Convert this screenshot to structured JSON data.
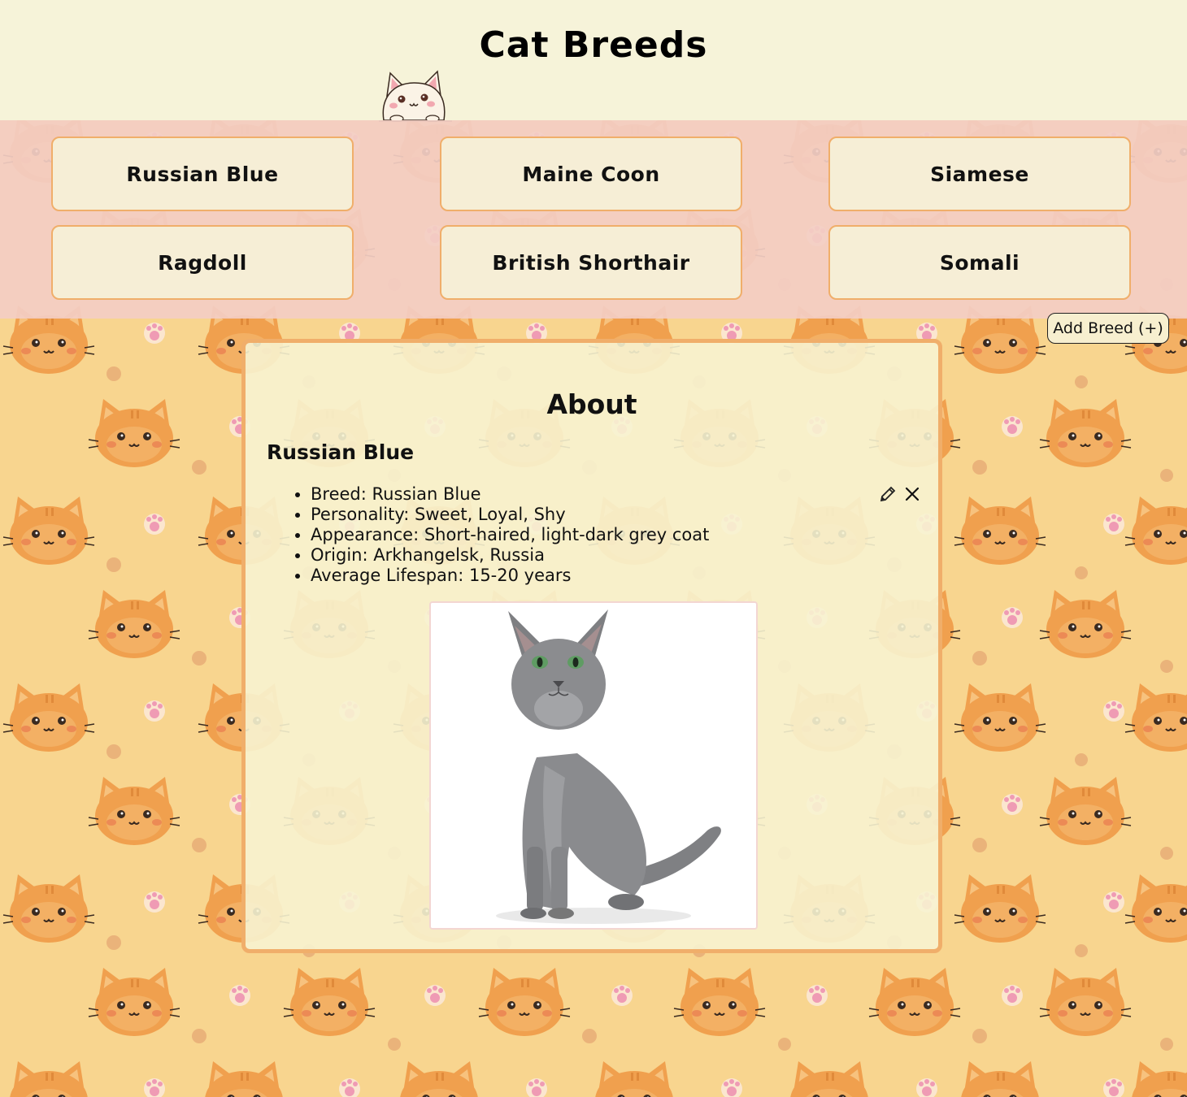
{
  "header": {
    "title": "Cat Breeds",
    "mascot_icon": "kawaii-cat-peeking-icon"
  },
  "breeds": [
    {
      "label": "Russian Blue"
    },
    {
      "label": "Maine Coon"
    },
    {
      "label": "Siamese"
    },
    {
      "label": "Ragdoll"
    },
    {
      "label": "British Shorthair"
    },
    {
      "label": "Somali"
    }
  ],
  "add_button": {
    "label": "Add Breed (+)"
  },
  "about": {
    "heading": "About",
    "selected_breed": "Russian Blue",
    "facts": [
      "Breed: Russian Blue",
      "Personality: Sweet, Loyal, Shy",
      "Appearance: Short-haired, light-dark grey coat",
      "Origin: Arkhangelsk, Russia",
      "Average Lifespan: 15-20 years"
    ],
    "edit_icon": "pencil-icon",
    "delete_icon": "close-icon",
    "photo_subject": "grey cat photo"
  },
  "colors": {
    "header_bg": "#f6f3d9",
    "band_bg": "#f3cdc4",
    "button_bg": "#f6eed6",
    "button_border": "#f0ae6a",
    "page_bg": "#f8d58f",
    "card_border": "#f0ae6a",
    "cat_pattern_orange": "#f0a04e"
  }
}
